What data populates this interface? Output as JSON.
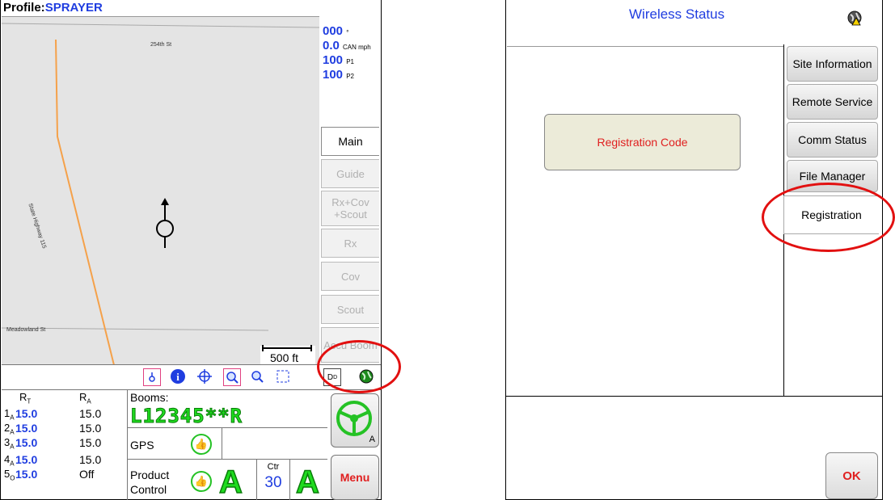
{
  "left_screen": {
    "profile_label": "Profile:",
    "profile_value": "SPRAYER",
    "map": {
      "street_top": "254th St",
      "street_diag": "State Highway 115",
      "street_bottom": "Meadowland St",
      "scale": "500 ft"
    },
    "readouts": [
      {
        "value": "000",
        "unit": "°"
      },
      {
        "value": "0.0",
        "unit": "CAN mph"
      },
      {
        "value": "100",
        "unit": "P1"
      },
      {
        "value": "100",
        "unit": "P2"
      }
    ],
    "tabs": [
      "Main",
      "Guide",
      "Rx+Cov +Scout",
      "Rx",
      "Cov",
      "Scout",
      "Accu Boom"
    ],
    "toolbar_icons": [
      "guidance-icon",
      "info-icon",
      "center-icon",
      "zoom-in-icon",
      "zoom-out-icon",
      "extents-icon",
      "dd-icon",
      "wireless-globe-icon"
    ],
    "stats": {
      "rt_header": "R",
      "rt_sub": "T",
      "ra_header": "R",
      "ra_sub": "A",
      "rows": [
        {
          "idx": "1",
          "sub": "A",
          "rt": "15.0",
          "ra": "15.0"
        },
        {
          "idx": "2",
          "sub": "A",
          "rt": "15.0",
          "ra": "15.0"
        },
        {
          "idx": "3",
          "sub": "A",
          "rt": "15.0",
          "ra": "15.0"
        },
        {
          "idx": "4",
          "sub": "A",
          "rt": "15.0",
          "ra": "15.0"
        },
        {
          "idx": "5",
          "sub": "O",
          "rt": "15.0",
          "ra": "Off"
        }
      ]
    },
    "booms_label": "Booms:",
    "booms_code": "L12345**R",
    "gps_label": "GPS",
    "product_label_1": "Product",
    "product_label_2": "Control",
    "auto_a": "A",
    "ctr_label": "Ctr",
    "ctr_value": "30",
    "steer_sub": "A",
    "menu_label": "Menu"
  },
  "right_screen": {
    "title": "Wireless Status",
    "registration_code_button": "Registration Code",
    "tabs": [
      "Site Information",
      "Remote Service",
      "Comm Status",
      "File Manager",
      "Registration"
    ],
    "ok_label": "OK"
  },
  "colors": {
    "accent_blue": "#1f3de0",
    "alert_red": "#e21010",
    "status_green": "#1fdc1f"
  }
}
